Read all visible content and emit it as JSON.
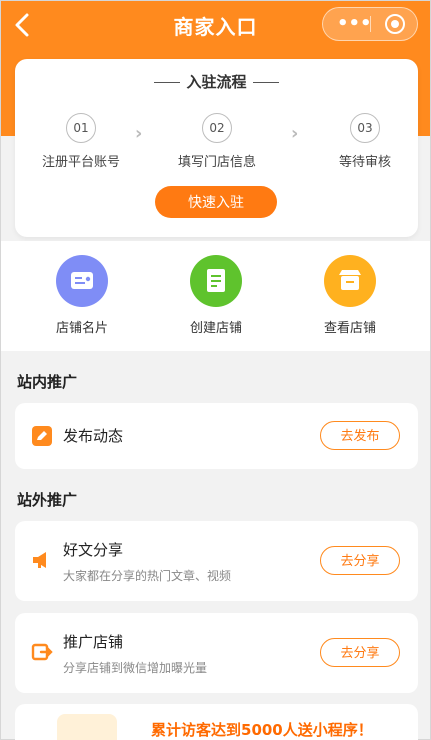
{
  "nav": {
    "title": "商家入口",
    "back_icon": "chevron-left-icon",
    "more_icon": "more-dots-icon",
    "close_icon": "target-close-icon",
    "more_glyph": "•••"
  },
  "process": {
    "title": "入驻流程",
    "steps": [
      {
        "num": "01",
        "label": "注册平台账号"
      },
      {
        "num": "02",
        "label": "填写门店信息"
      },
      {
        "num": "03",
        "label": "等待审核"
      }
    ],
    "join_label": "快速入驻"
  },
  "quick_actions": [
    {
      "label": "店铺名片",
      "icon": "card-icon",
      "color": "#7f8df6"
    },
    {
      "label": "创建店铺",
      "icon": "doc-icon",
      "color": "#5fc32d"
    },
    {
      "label": "查看店铺",
      "icon": "store-icon",
      "color": "#ffb11f"
    }
  ],
  "onsite": {
    "title": "站内推广",
    "items": [
      {
        "title": "发布动态",
        "button": "去发布",
        "icon": "edit-icon"
      }
    ]
  },
  "offsite": {
    "title": "站外推广",
    "items": [
      {
        "title": "好文分享",
        "subtitle": "大家都在分享的热门文章、视频",
        "button": "去分享",
        "icon": "megaphone-icon"
      },
      {
        "title": "推广店铺",
        "subtitle": "分享店铺到微信增加曝光量",
        "button": "去分享",
        "icon": "share-store-icon"
      }
    ]
  },
  "promo": {
    "text": "累计访客达到5000人送小程序！"
  },
  "colors": {
    "brand": "#ff8a1e",
    "accent": "#ff7a12"
  }
}
